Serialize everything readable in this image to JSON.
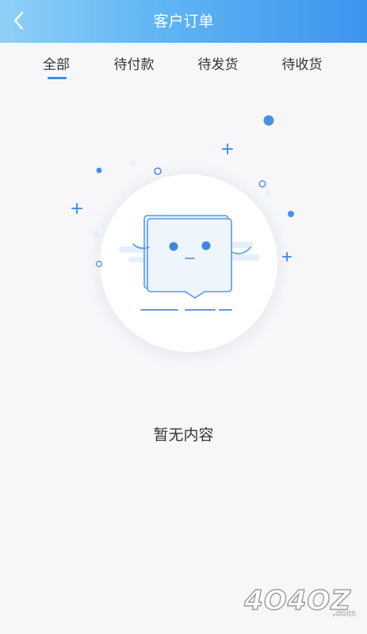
{
  "header": {
    "title": "客户订单",
    "back_icon": "chevron-left-icon"
  },
  "tabs": [
    {
      "label": "全部",
      "active": true
    },
    {
      "label": "待付款",
      "active": false
    },
    {
      "label": "待发货",
      "active": false
    },
    {
      "label": "待收货",
      "active": false
    }
  ],
  "empty_state": {
    "illustration": "empty-box-character-illustration",
    "message": "暂无内容"
  },
  "watermark": {
    "text": "4O4OZ",
    "suffix": ".com"
  },
  "colors": {
    "header_gradient_start": "#8fd0f7",
    "header_gradient_end": "#3d94ee",
    "accent": "#3d8fe8",
    "background": "#f7f7f9",
    "text": "#333333"
  }
}
